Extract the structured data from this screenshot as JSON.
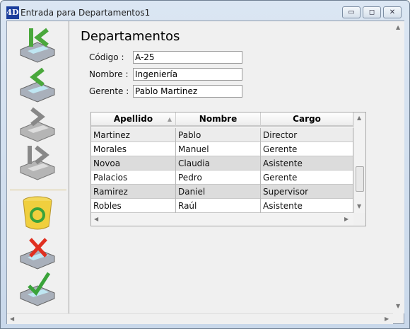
{
  "window": {
    "title": "Entrada para Departamentos1",
    "logo": "4D",
    "minimize": "▭",
    "maximize": "◻",
    "close": "✕"
  },
  "toolbar": [
    {
      "name": "first-record",
      "icon": "first-record-icon"
    },
    {
      "name": "previous-record",
      "icon": "previous-record-icon"
    },
    {
      "name": "next-record",
      "icon": "next-record-icon"
    },
    {
      "name": "last-record",
      "icon": "last-record-icon"
    },
    {
      "name": "delete-record",
      "icon": "trash-icon"
    },
    {
      "name": "cancel",
      "icon": "cancel-icon"
    },
    {
      "name": "accept",
      "icon": "accept-icon"
    }
  ],
  "form": {
    "heading": "Departamentos",
    "fields": [
      {
        "label": "Código :",
        "value": "A-25"
      },
      {
        "label": "Nombre :",
        "value": "Ingeniería"
      },
      {
        "label": "Gerente :",
        "value": "Pablo Martinez"
      }
    ]
  },
  "table": {
    "columns": [
      "Apellido",
      "Nombre",
      "Cargo"
    ],
    "sort_indicator": "▲",
    "rows": [
      [
        "Martinez",
        "Pablo",
        "Director"
      ],
      [
        "Morales",
        "Manuel",
        "Gerente"
      ],
      [
        "Novoa",
        "Claudia",
        "Asistente"
      ],
      [
        "Palacios",
        "Pedro",
        "Gerente"
      ],
      [
        "Ramirez",
        "Daniel",
        "Supervisor"
      ],
      [
        "Robles",
        "Raúl",
        "Asistente"
      ]
    ]
  }
}
